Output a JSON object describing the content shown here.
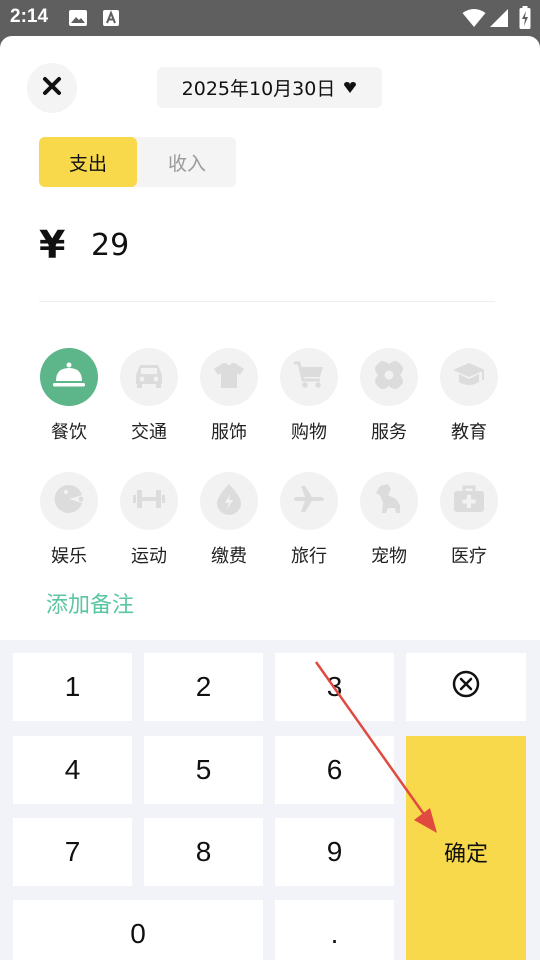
{
  "status_bar": {
    "time": "2:14"
  },
  "header": {
    "date": "2025年10月30日"
  },
  "type_toggle": {
    "expense": "支出",
    "income": "收入"
  },
  "amount": {
    "currency": "¥",
    "value": "29"
  },
  "categories": [
    {
      "label": "餐饮",
      "icon": "dining-bell-icon",
      "selected": true
    },
    {
      "label": "交通",
      "icon": "car-icon"
    },
    {
      "label": "服饰",
      "icon": "shirt-icon"
    },
    {
      "label": "购物",
      "icon": "cart-icon"
    },
    {
      "label": "服务",
      "icon": "service-icon"
    },
    {
      "label": "教育",
      "icon": "graduation-cap-icon"
    },
    {
      "label": "娱乐",
      "icon": "game-icon"
    },
    {
      "label": "运动",
      "icon": "dumbbell-icon"
    },
    {
      "label": "缴费",
      "icon": "bill-drop-icon"
    },
    {
      "label": "旅行",
      "icon": "plane-icon"
    },
    {
      "label": "宠物",
      "icon": "dog-icon"
    },
    {
      "label": "医疗",
      "icon": "medical-kit-icon"
    }
  ],
  "note_link": "添加备注",
  "keypad": {
    "keys": [
      "1",
      "2",
      "3",
      "4",
      "5",
      "6",
      "7",
      "8",
      "9",
      "0",
      "."
    ],
    "confirm": "确定"
  },
  "colors": {
    "accent_yellow": "#f8d94b",
    "accent_green": "#5db58a",
    "link_green": "#5cc6a0",
    "annotation_arrow": "#e04a3f"
  }
}
